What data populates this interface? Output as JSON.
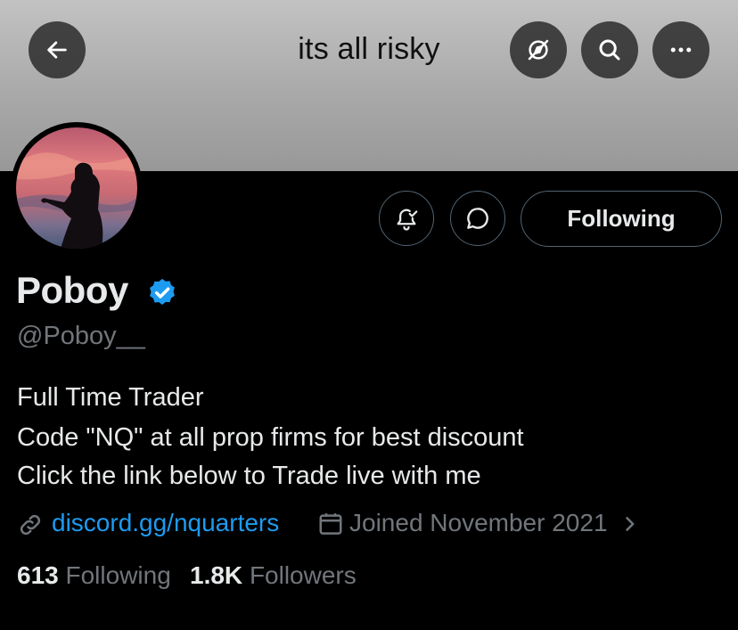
{
  "header": {
    "title": "its all risky",
    "back_icon": "arrow-left-icon",
    "actions": [
      "explore-off-icon",
      "search-icon",
      "more-icon"
    ]
  },
  "profile": {
    "name": "Poboy",
    "verified": true,
    "verified_color": "#1d9bf0",
    "handle": "@Poboy__",
    "bio": [
      "Full Time Trader",
      "Code \"NQ\" at all prop firms for best discount",
      "Click the link below to Trade live with me"
    ],
    "link": "discord.gg/nquarters",
    "joined": "Joined November 2021",
    "following_count": "613",
    "following_label": "Following",
    "followers_count": "1.8K",
    "followers_label": "Followers"
  },
  "actions": {
    "notifications_icon": "bell-check-icon",
    "message_icon": "message-icon",
    "follow_state": "Following"
  }
}
